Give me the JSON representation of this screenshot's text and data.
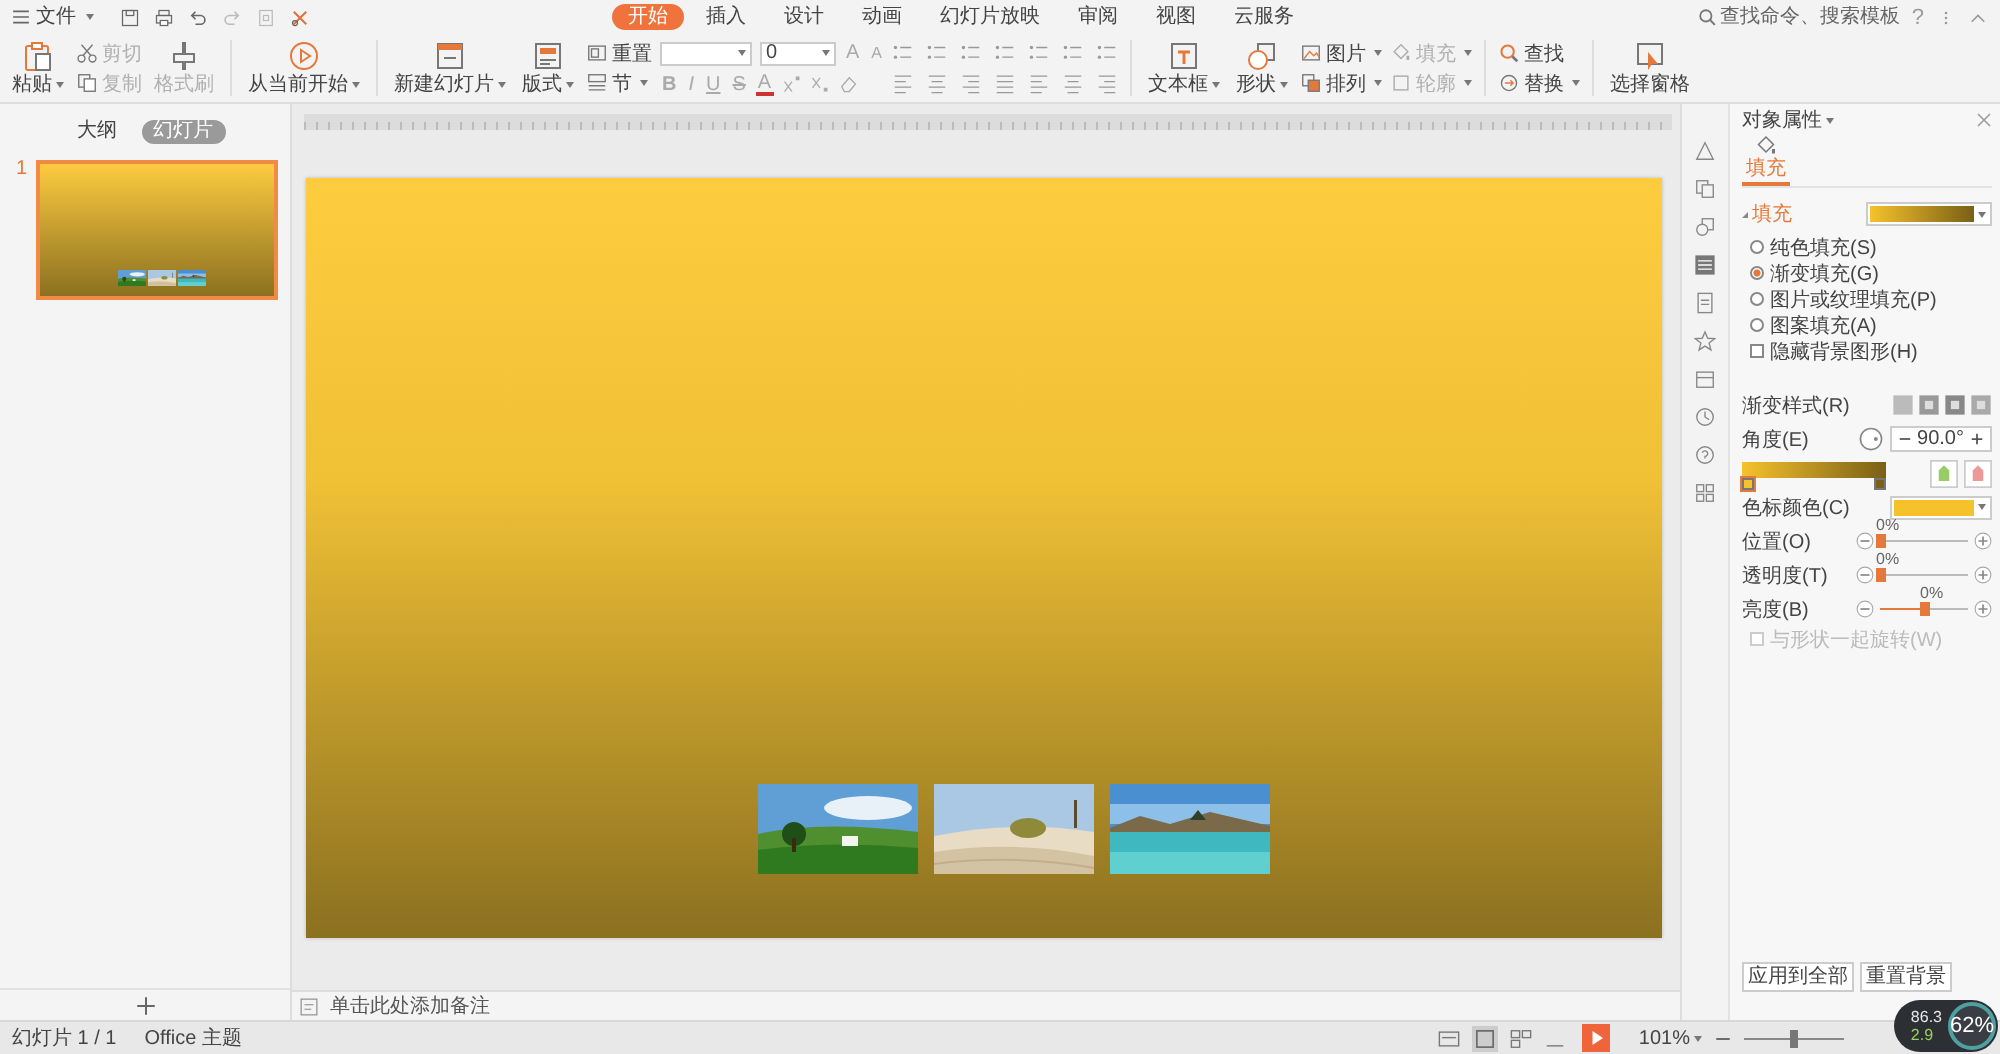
{
  "menu": {
    "file": "文件"
  },
  "tabs": [
    {
      "label": "开始",
      "selected": true
    },
    {
      "label": "插入",
      "selected": false
    },
    {
      "label": "设计",
      "selected": false
    },
    {
      "label": "动画",
      "selected": false
    },
    {
      "label": "幻灯片放映",
      "selected": false
    },
    {
      "label": "审阅",
      "selected": false
    },
    {
      "label": "视图",
      "selected": false
    },
    {
      "label": "云服务",
      "selected": false
    }
  ],
  "search": {
    "placeholder": "查找命令、搜索模板"
  },
  "help": "?",
  "ribbon": [
    {
      "kind": "large",
      "label": "粘贴",
      "dropdown": true,
      "disabled": false
    },
    {
      "kind": "stack",
      "items": [
        {
          "label": "剪切",
          "dropdown": false,
          "disabled": true
        },
        {
          "label": "复制",
          "dropdown": false,
          "disabled": true
        }
      ]
    },
    {
      "kind": "large",
      "label": "格式刷",
      "dropdown": false,
      "disabled": true
    },
    {
      "kind": "separator"
    },
    {
      "kind": "large",
      "label": "从当前开始",
      "dropdown": true,
      "disabled": false
    },
    {
      "kind": "separator"
    },
    {
      "kind": "large",
      "label": "新建幻灯片",
      "dropdown": true,
      "disabled": false
    },
    {
      "kind": "large",
      "label": "版式",
      "dropdown": true,
      "disabled": false
    },
    {
      "kind": "stack",
      "items": [
        {
          "label": "重置",
          "dropdown": false,
          "disabled": false
        },
        {
          "label": "节",
          "dropdown": true,
          "disabled": false
        }
      ]
    },
    {
      "kind": "font",
      "font_size": "0",
      "size_buttons": [
        "A",
        "A"
      ],
      "format_buttons": [
        "B",
        "I",
        "U",
        "S",
        "A"
      ]
    },
    {
      "kind": "paragraph"
    },
    {
      "kind": "separator"
    },
    {
      "kind": "large",
      "label": "文本框",
      "dropdown": true,
      "disabled": false
    },
    {
      "kind": "large",
      "label": "形状",
      "dropdown": true,
      "disabled": false
    },
    {
      "kind": "stack",
      "items": [
        {
          "label": "图片",
          "dropdown": true,
          "disabled": false
        },
        {
          "label": "排列",
          "dropdown": true,
          "disabled": false
        }
      ]
    },
    {
      "kind": "stack",
      "items": [
        {
          "label": "填充",
          "dropdown": true,
          "disabled": true
        },
        {
          "label": "轮廓",
          "dropdown": true,
          "disabled": true
        }
      ]
    },
    {
      "kind": "separator"
    },
    {
      "kind": "stack",
      "items": [
        {
          "label": "查找",
          "dropdown": false,
          "disabled": false
        },
        {
          "label": "替换",
          "dropdown": true,
          "disabled": false
        }
      ]
    },
    {
      "kind": "separator"
    },
    {
      "kind": "large",
      "label": "选择窗格",
      "dropdown": false,
      "disabled": false
    }
  ],
  "outline_tabs": [
    {
      "label": "大纲",
      "selected": false
    },
    {
      "label": "幻灯片",
      "selected": true
    }
  ],
  "slides": [
    {
      "number": "1",
      "selected": true
    }
  ],
  "notes_placeholder": "单击此处添加备注",
  "panel": {
    "title": "对象属性",
    "tabs": [
      {
        "label": "填充",
        "selected": true
      }
    ],
    "section": "填充",
    "fill_options": [
      {
        "label": "纯色填充(S)",
        "selected": false
      },
      {
        "label": "渐变填充(G)",
        "selected": true
      },
      {
        "label": "图片或纹理填充(P)",
        "selected": false
      },
      {
        "label": "图案填充(A)",
        "selected": false
      }
    ],
    "hide_background": {
      "label": "隐藏背景图形(H)",
      "checked": false
    },
    "gradient_style": "渐变样式(R)",
    "angle": {
      "label": "角度(E)",
      "value": "90.0°"
    },
    "stops": [
      {
        "color": "#f5c22c",
        "selected": true
      },
      {
        "color": "#7a5f16",
        "selected": false
      }
    ],
    "stop_color": "色标颜色(C)",
    "sliders": [
      {
        "label": "位置(O)",
        "reading": "0%",
        "level": 0
      },
      {
        "label": "透明度(T)",
        "reading": "0%",
        "level": 0
      },
      {
        "label": "亮度(B)",
        "reading": "0%",
        "level": 0.5
      }
    ],
    "rotate_with_shape": {
      "label": "与形状一起旋转(W)",
      "checked": false,
      "disabled": true
    },
    "buttons": [
      "应用到全部",
      "重置背景"
    ]
  },
  "status_bar": {
    "slide_counter": "幻灯片 1 / 1",
    "theme": "Office 主题",
    "zoom": "101%",
    "zoom_slider": {
      "level": 0.5
    }
  },
  "speed_widget": {
    "percent": "62%",
    "upload": "86.3",
    "download": "2.9"
  }
}
